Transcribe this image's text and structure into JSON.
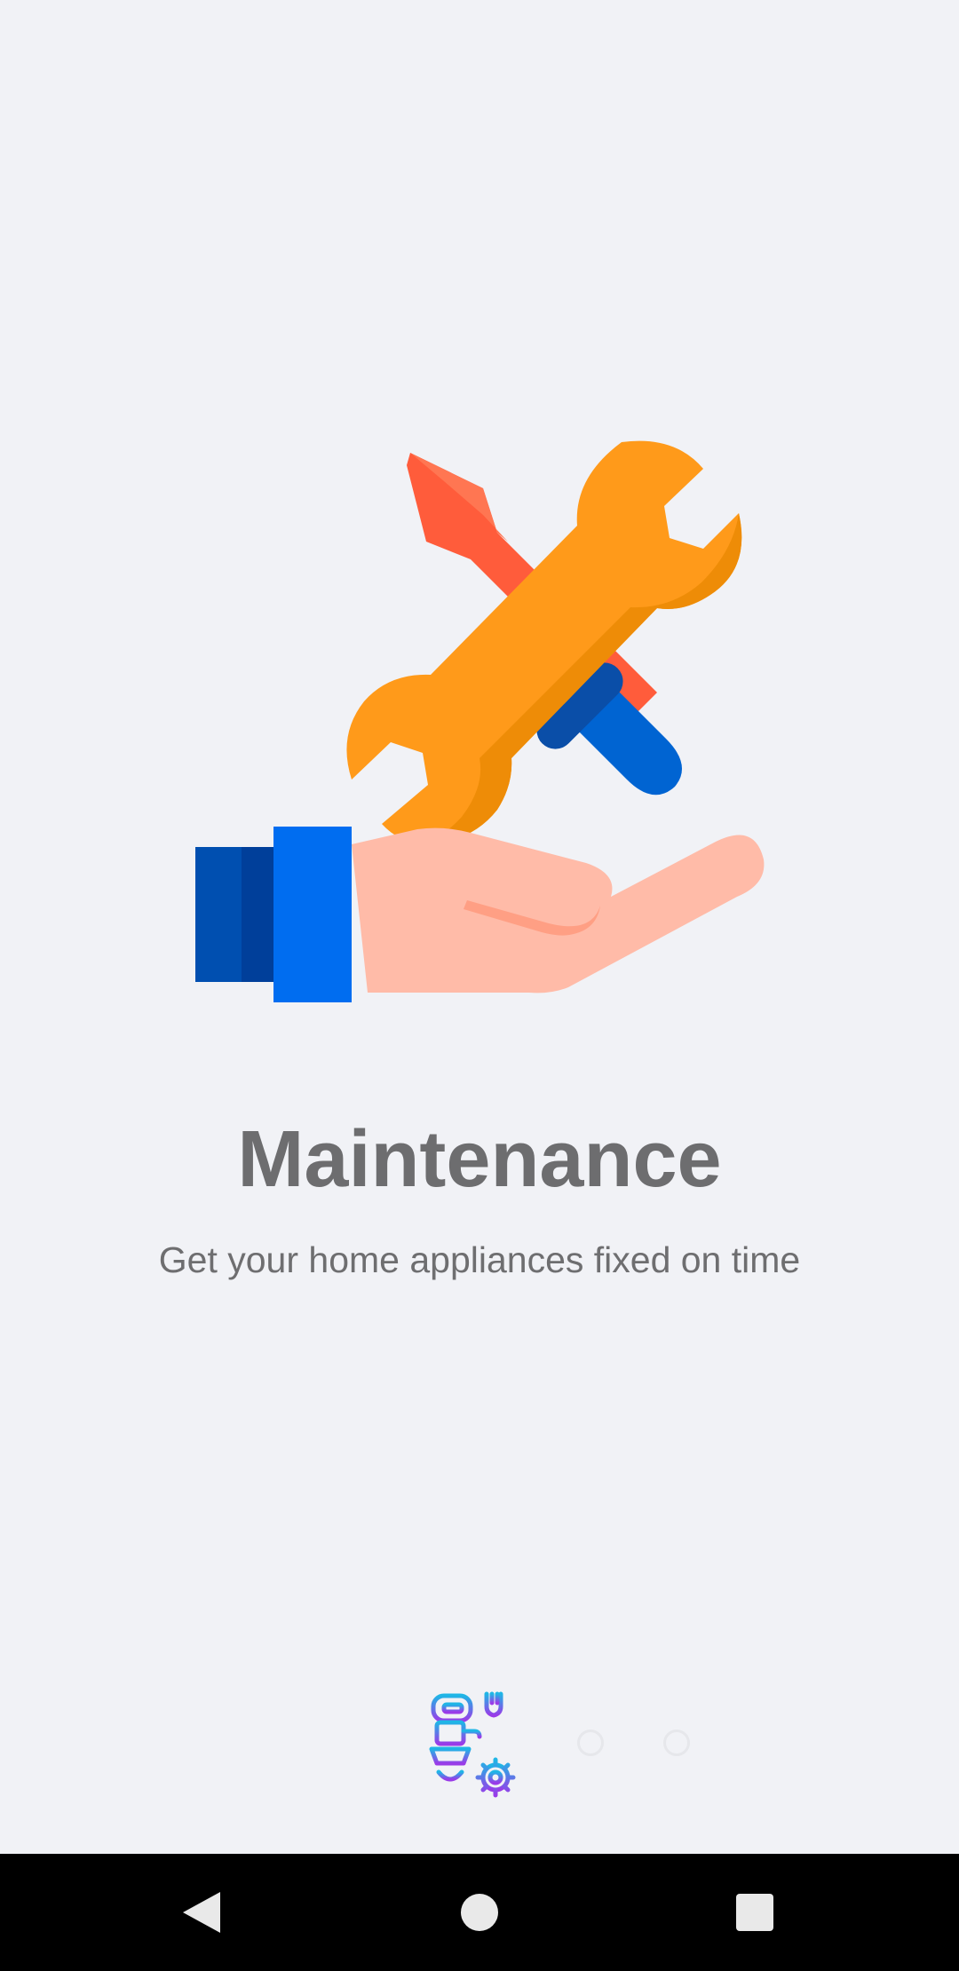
{
  "onboarding": {
    "title": "Maintenance",
    "subtitle": "Get your home appliances fixed on time",
    "illustration_icon": "hand-holding-tools-icon",
    "pager": {
      "current_page_icon": "robot-wrench-gear-icon",
      "total_pages": 3,
      "current_page": 1
    }
  },
  "system_nav": {
    "back_icon": "back-triangle-icon",
    "home_icon": "home-circle-icon",
    "recents_icon": "recents-square-icon"
  },
  "colors": {
    "background": "#f1f2f6",
    "title": "#6d6d6f",
    "subtitle": "#6e6e70",
    "wrench": "#ff9a1a",
    "screwdriver_blade": "#ff5c3b",
    "screwdriver_handle": "#0064d2",
    "sleeve": "#006df0",
    "hand": "#ffbba8"
  }
}
